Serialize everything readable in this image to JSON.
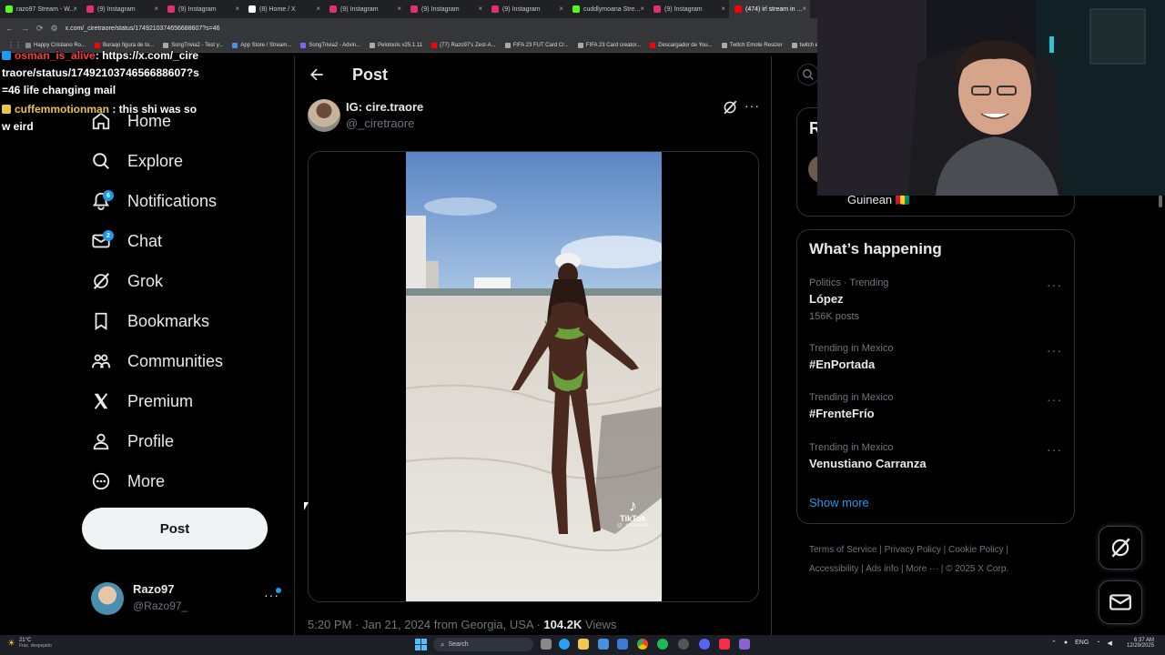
{
  "browser": {
    "tabs": [
      {
        "label": "razo97 Stream - W...",
        "color": "#53fc18",
        "active": false
      },
      {
        "label": "(9) Instagram",
        "color": "#e1306c",
        "active": false
      },
      {
        "label": "(9) Instagram",
        "color": "#e1306c",
        "active": false
      },
      {
        "label": "(8) Home / X",
        "color": "#ffffff",
        "active": false
      },
      {
        "label": "(9) Instagram",
        "color": "#e1306c",
        "active": false
      },
      {
        "label": "(9) Instagram",
        "color": "#e1306c",
        "active": false
      },
      {
        "label": "(9) Instagram",
        "color": "#e1306c",
        "active": false
      },
      {
        "label": "cuddlymoana Stre...",
        "color": "#53fc18",
        "active": false
      },
      {
        "label": "(9) Instagram",
        "color": "#e1306c",
        "active": false
      },
      {
        "label": "(474) irl stream in ...",
        "color": "#ff0000",
        "active": true
      }
    ],
    "url": "x.com/_ciretraore/status/1749210374656688607?s=46",
    "bookmarks": [
      {
        "label": "Happy Cristiano Ro...",
        "color": "#888888"
      },
      {
        "label": "Buraqo figura de to...",
        "color": "#ff0000"
      },
      {
        "label": "SongTrivia2 - Test y...",
        "color": "#aaaaaa"
      },
      {
        "label": "App Store / Stream...",
        "color": "#4a90e2"
      },
      {
        "label": "SongTrivia2 - Advin...",
        "color": "#7b68ee"
      },
      {
        "label": "Pelotools v25.1.11",
        "color": "#aaaaaa"
      },
      {
        "label": "(77) Razo97's Zest-A...",
        "color": "#ff0000"
      },
      {
        "label": "FIFA 23 FUT Card Cr...",
        "color": "#aaaaaa"
      },
      {
        "label": "FIFA 23 Card creator...",
        "color": "#aaaaaa"
      },
      {
        "label": "Descargador de You...",
        "color": "#ff0000"
      },
      {
        "label": "Twitch Emote Resizer",
        "color": "#aaaaaa"
      },
      {
        "label": "twitch em...",
        "color": "#aaaaaa"
      }
    ]
  },
  "chat": {
    "messages": [
      {
        "user": "osman_is_alive",
        "user_color": "#ff3b3b",
        "text": ": https://x.com/_ciretraore/status/1749210374656688607?s=46 life changing mail"
      },
      {
        "user": "cuffemmotionman",
        "user_color": "#e8c34a",
        "text": " : this shi was sow eird"
      }
    ]
  },
  "nav": {
    "items": [
      {
        "key": "home",
        "label": "Home",
        "icon": "home-icon"
      },
      {
        "key": "explore",
        "label": "Explore",
        "icon": "search-icon"
      },
      {
        "key": "notifications",
        "label": "Notifications",
        "icon": "bell-icon",
        "badge": "6"
      },
      {
        "key": "chat",
        "label": "Chat",
        "icon": "mail-icon",
        "badge": "2"
      },
      {
        "key": "grok",
        "label": "Grok",
        "icon": "grok-icon"
      },
      {
        "key": "bookmarks",
        "label": "Bookmarks",
        "icon": "bookmark-icon"
      },
      {
        "key": "communities",
        "label": "Communities",
        "icon": "people-icon"
      },
      {
        "key": "premium",
        "label": "Premium",
        "icon": "x-logo-icon"
      },
      {
        "key": "profile",
        "label": "Profile",
        "icon": "person-icon"
      },
      {
        "key": "more",
        "label": "More",
        "icon": "more-circle-icon"
      }
    ],
    "post_button": "Post",
    "account": {
      "name": "Razo97",
      "handle": "@Razo97_"
    }
  },
  "post": {
    "header_title": "Post",
    "author_name": "IG: cire.traore",
    "author_handle": "@_ciretraore",
    "timestamp": "5:20 PM · Jan 21, 2024 from Georgia, USA · ",
    "views_count": "104.2K",
    "views_label": " Views",
    "tiktok_label": "TikTok",
    "tiktok_handle": "@_ciretraore"
  },
  "sidebar": {
    "partial_card_letter": "R",
    "partial_card_text": "Guinean 🇬🇳",
    "whats_happening_title": "What’s happening",
    "trends": [
      {
        "meta": "Politics · Trending",
        "name": "López",
        "count": "156K posts"
      },
      {
        "meta": "Trending in Mexico",
        "name": "#EnPortada",
        "count": ""
      },
      {
        "meta": "Trending in Mexico",
        "name": "#FrenteFrío",
        "count": ""
      },
      {
        "meta": "Trending in Mexico",
        "name": "Venustiano Carranza",
        "count": ""
      }
    ],
    "show_more": "Show more",
    "footer_links": [
      "Terms of Service",
      "Privacy Policy",
      "Cookie Policy",
      "Accessibility",
      "Ads info",
      "More ···",
      "© 2025 X Corp."
    ]
  },
  "taskbar": {
    "weather_temp": "21°C",
    "weather_desc": "Frac. despejado",
    "search_placeholder": "Search",
    "language": "ENG",
    "time": "6:37 AM",
    "date": "12/29/2025"
  },
  "colors": {
    "x_blue": "#1d9bf0",
    "background": "#000000",
    "border": "#2f3336",
    "muted_text": "#71767b"
  }
}
